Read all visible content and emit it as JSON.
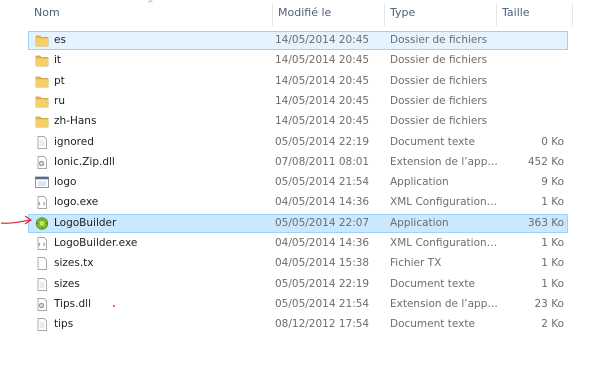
{
  "columns": {
    "name": "Nom",
    "modified": "Modifié le",
    "type": "Type",
    "size": "Taille"
  },
  "files": [
    {
      "name": "es",
      "modified": "14/05/2014 20:45",
      "type": "Dossier de fichiers",
      "size": "",
      "icon": "folder-icon",
      "state": "selected"
    },
    {
      "name": "it",
      "modified": "14/05/2014 20:45",
      "type": "Dossier de fichiers",
      "size": "",
      "icon": "folder-icon",
      "state": ""
    },
    {
      "name": "pt",
      "modified": "14/05/2014 20:45",
      "type": "Dossier de fichiers",
      "size": "",
      "icon": "folder-icon",
      "state": ""
    },
    {
      "name": "ru",
      "modified": "14/05/2014 20:45",
      "type": "Dossier de fichiers",
      "size": "",
      "icon": "folder-icon",
      "state": ""
    },
    {
      "name": "zh-Hans",
      "modified": "14/05/2014 20:45",
      "type": "Dossier de fichiers",
      "size": "",
      "icon": "folder-icon",
      "state": ""
    },
    {
      "name": "ignored",
      "modified": "05/05/2014 22:19",
      "type": "Document texte",
      "size": "0 Ko",
      "icon": "text-file-icon",
      "state": ""
    },
    {
      "name": "Ionic.Zip.dll",
      "modified": "07/08/2011 08:01",
      "type": "Extension de l’app…",
      "size": "452 Ko",
      "icon": "dll-file-icon",
      "state": ""
    },
    {
      "name": "logo",
      "modified": "05/05/2014 21:54",
      "type": "Application",
      "size": "9 Ko",
      "icon": "application-icon",
      "state": ""
    },
    {
      "name": "logo.exe",
      "modified": "04/05/2014 14:36",
      "type": "XML Configuration…",
      "size": "1 Ko",
      "icon": "config-file-icon",
      "state": ""
    },
    {
      "name": "LogoBuilder",
      "modified": "05/05/2014 22:07",
      "type": "Application",
      "size": "363 Ko",
      "icon": "logobuilder-app-icon",
      "state": "highlight"
    },
    {
      "name": "LogoBuilder.exe",
      "modified": "04/05/2014 14:36",
      "type": "XML Configuration…",
      "size": "1 Ko",
      "icon": "config-file-icon",
      "state": ""
    },
    {
      "name": "sizes.tx",
      "modified": "04/05/2014 15:38",
      "type": "Fichier TX",
      "size": "1 Ko",
      "icon": "generic-file-icon",
      "state": ""
    },
    {
      "name": "sizes",
      "modified": "05/05/2014 22:19",
      "type": "Document texte",
      "size": "1 Ko",
      "icon": "text-file-icon",
      "state": ""
    },
    {
      "name": "Tips.dll",
      "modified": "05/05/2014 21:54",
      "type": "Extension de l’app…",
      "size": "23 Ko",
      "icon": "dll-file-icon",
      "state": ""
    },
    {
      "name": "tips",
      "modified": "08/12/2012 17:54",
      "type": "Document texte",
      "size": "2 Ko",
      "icon": "text-file-icon",
      "state": ""
    }
  ],
  "colors": {
    "selection_bg": "#e5f3ff",
    "highlight_bg": "#cce8ff",
    "selection_border": "#99d1ff",
    "header_text": "#4c607a",
    "annotation_red": "#e0303a"
  }
}
